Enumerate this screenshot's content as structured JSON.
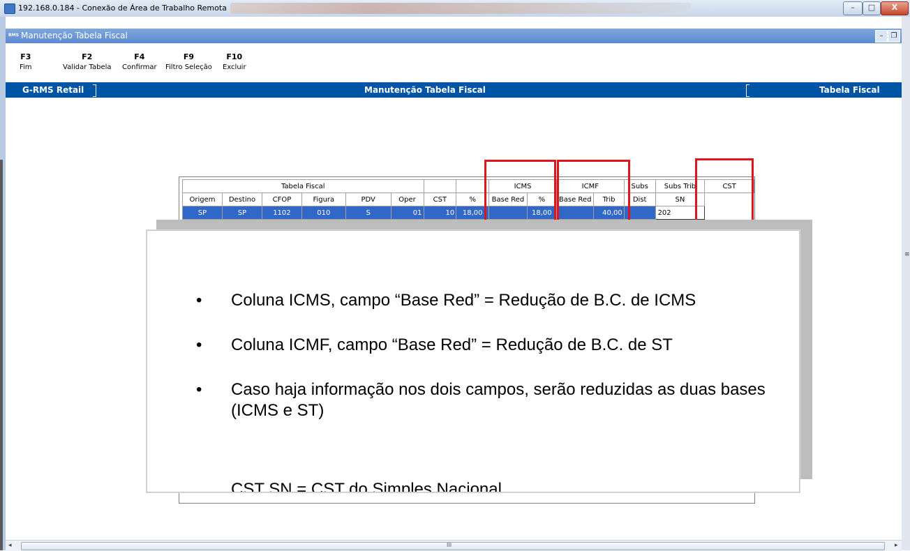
{
  "window": {
    "title": "192.168.0.184 - Conexão de Área de Trabalho Remota",
    "minimize": "–",
    "maximize": "□",
    "close": "X"
  },
  "inner_window": {
    "logo": "RMS",
    "title": "Manutenção Tabela Fiscal"
  },
  "fkeys": [
    {
      "key": "F3",
      "label": "Fim"
    },
    {
      "key": "F2",
      "label": "Validar Tabela"
    },
    {
      "key": "F4",
      "label": "Confirmar"
    },
    {
      "key": "F9",
      "label": "Filtro Seleção"
    },
    {
      "key": "F10",
      "label": "Excluir"
    }
  ],
  "header_band": {
    "left": "G-RMS Retail",
    "center": "Manutenção Tabela Fiscal",
    "right": "Tabela Fiscal"
  },
  "table": {
    "groups": {
      "tabela_fiscal": "Tabela Fiscal",
      "icms": "ICMS",
      "icmf": "ICMF",
      "subs": "Subs",
      "subs_trib": "Subs Trib",
      "cst": "CST"
    },
    "columns": [
      "Origem",
      "Destino",
      "CFOP",
      "Figura",
      "PDV",
      "Oper",
      "CST",
      "%",
      "Base Red",
      "%",
      "Base Red",
      "Trib",
      "Dist",
      "SN"
    ],
    "row": {
      "origem": "SP",
      "destino": "SP",
      "cfop": "1102",
      "figura": "010",
      "pdv": "S",
      "oper": "01",
      "cst": "10",
      "icms_pct": "18,00",
      "icms_base_red": "",
      "icmf_pct": "18,00",
      "icmf_base_red": "",
      "subs_trib": "40,00",
      "subs_dist": "",
      "cst_sn": "202"
    }
  },
  "popup": {
    "bullet": "•",
    "items": [
      "Coluna ICMS, campo “Base Red” = Redução de B.C. de ICMS",
      "Coluna ICMF, campo “Base Red” = Redução de B.C. de ST",
      "Caso haja informação nos dois campos, serão reduzidas as duas bases (ICMS e ST)"
    ],
    "cut_text": "CST SN = CST do Simples Nacional"
  },
  "scrollbar": {
    "left_arrow": "◂",
    "right_arrow": "▸",
    "grip": "III",
    "side_grip": "≡"
  }
}
